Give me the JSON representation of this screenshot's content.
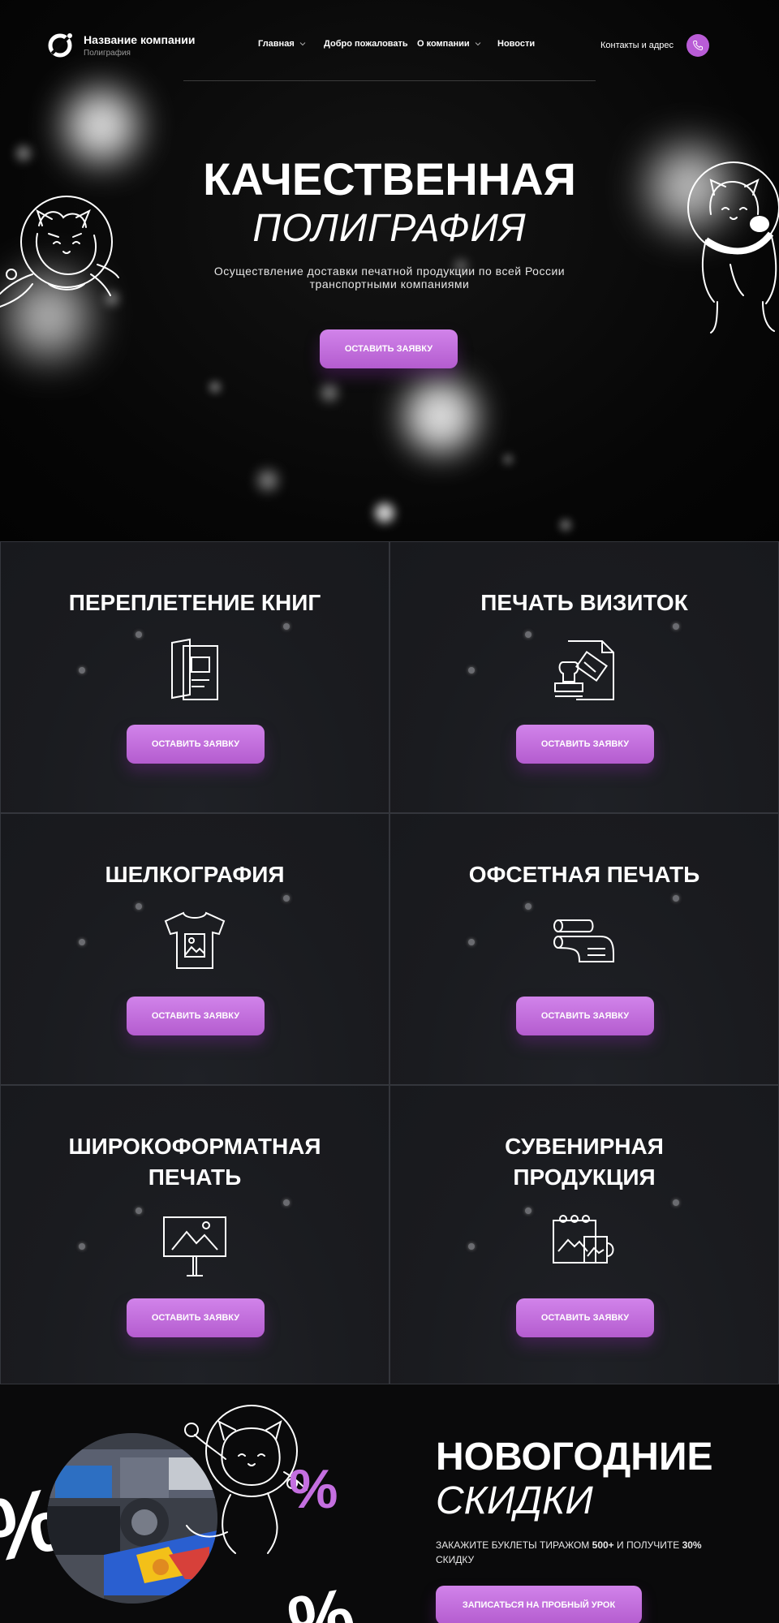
{
  "header": {
    "company_name": "Название компании",
    "company_sub": "Полиграфия",
    "nav": [
      {
        "label": "Главная",
        "dropdown": true
      },
      {
        "label": "Добро пожаловать",
        "dropdown": false
      },
      {
        "label": "О компании",
        "dropdown": true
      },
      {
        "label": "Новости",
        "dropdown": false
      }
    ],
    "contacts_label": "Контакты и адрес",
    "phone_icon": "phone-icon"
  },
  "hero": {
    "title_line1": "КАЧЕСТВЕННАЯ",
    "title_line2": "ПОЛИГРАФИЯ",
    "description": "Осуществление доставки печатной продукции по всей России транспортными компаниями",
    "cta_label": "ОСТАВИТЬ ЗАЯВКУ"
  },
  "services": [
    {
      "title": "ПЕРЕПЛЕТЕНИЕ КНИГ",
      "icon": "book-binding-icon",
      "button": "ОСТАВИТЬ ЗАЯВКУ"
    },
    {
      "title": "ПЕЧАТЬ ВИЗИТОК",
      "icon": "stamp-document-icon",
      "button": "ОСТАВИТЬ ЗАЯВКУ"
    },
    {
      "title": "ШЕЛКОГРАФИЯ",
      "icon": "tshirt-print-icon",
      "button": "ОСТАВИТЬ ЗАЯВКУ"
    },
    {
      "title": "ОФСЕТНАЯ ПЕЧАТЬ",
      "icon": "paper-rolls-icon",
      "button": "ОСТАВИТЬ ЗАЯВКУ"
    },
    {
      "title": "ШИРОКОФОРМАТНАЯ ПЕЧАТЬ",
      "title_lines": [
        "ШИРОКОФОРМАТНАЯ",
        "ПЕЧАТЬ"
      ],
      "icon": "banner-stand-icon",
      "button": "ОСТАВИТЬ ЗАЯВКУ"
    },
    {
      "title": "СУВЕНИРНАЯ ПРОДУКЦИЯ",
      "title_lines": [
        "СУВЕНИРНАЯ",
        "ПРОДУКЦИЯ"
      ],
      "icon": "calendar-mug-icon",
      "button": "ОСТАВИТЬ ЗАЯВКУ"
    }
  ],
  "promo": {
    "title_line1": "НОВОГОДНИЕ",
    "title_line2": "СКИДКИ",
    "description_pre": "ЗАКАЖИТЕ БУКЛЕТЫ ТИРАЖОМ ",
    "description_bold1": "500+",
    "description_mid": " И ПОЛУЧИТЕ ",
    "description_bold2": "30%",
    "description_post": " СКИДКУ",
    "cta_label": "ЗАПИСАТЬСЯ НА ПРОБНЫЙ УРОК",
    "percent_sign": "%"
  },
  "colors": {
    "accent": "#c46fe0",
    "accent_dark": "#b45ccf",
    "background": "#0a0a0b",
    "card_bg": "#1c1d21",
    "card_border": "#34363c"
  }
}
